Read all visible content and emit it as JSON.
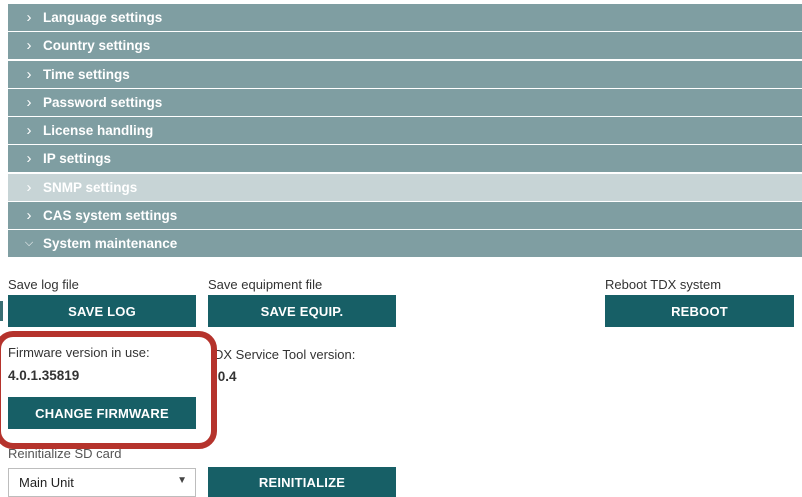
{
  "menu": {
    "items": [
      {
        "label": "Language settings",
        "icon": "chevron-right-icon"
      },
      {
        "label": "Country settings",
        "icon": "chevron-right-icon"
      },
      {
        "label": "Time settings",
        "icon": "chevron-right-icon"
      },
      {
        "label": "Password settings",
        "icon": "chevron-right-icon"
      },
      {
        "label": "License handling",
        "icon": "chevron-right-icon"
      },
      {
        "label": "IP settings",
        "icon": "chevron-right-icon"
      },
      {
        "label": "SNMP settings",
        "icon": "chevron-right-icon"
      },
      {
        "label": "CAS system settings",
        "icon": "chevron-right-icon"
      },
      {
        "label": "System maintenance",
        "icon": "chevron-down-icon"
      }
    ]
  },
  "maintenance": {
    "save_log": {
      "label": "Save log file",
      "button": "SAVE LOG"
    },
    "save_equipment": {
      "label": "Save equipment file",
      "button": "SAVE EQUIP."
    },
    "reboot": {
      "label": "Reboot TDX system",
      "button": "REBOOT"
    },
    "firmware": {
      "label": "Firmware version in use:",
      "value": "4.0.1.35819",
      "button": "CHANGE FIRMWARE"
    },
    "service_tool": {
      "label": "DX Service Tool version:",
      "value": ".0.4"
    },
    "reinitialize": {
      "label": "Reinitialize SD card",
      "select_value": "Main Unit",
      "button": "REINITIALIZE"
    }
  },
  "colors": {
    "menu_row": "#7f9ea2",
    "menu_row_active": "#c7d4d6",
    "button": "#175f66",
    "highlight": "#b5332c"
  }
}
